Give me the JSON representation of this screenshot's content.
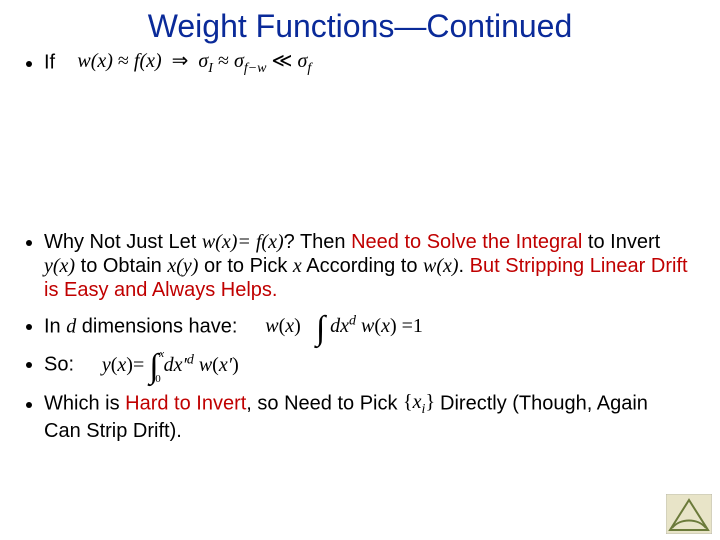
{
  "title": "Weight Functions—Continued",
  "bullets": {
    "b1_lead": "If",
    "b1_formula_wx": "w(x)",
    "b1_formula_approx": "≈",
    "b1_formula_fx": "f(x)",
    "b1_formula_implies": "⇒",
    "b1_formula_sigmaI": "σ",
    "b1_formula_sigmaI_sub": "I",
    "b1_formula_sigmafw": "σ",
    "b1_formula_sigmafw_sub": "f−w",
    "b1_formula_ll": "≪",
    "b1_formula_sigmaf": "σ",
    "b1_formula_sigmaf_sub": "f",
    "b2_p1": "Why Not Just Let ",
    "b2_wx": "w(x)= f(x)",
    "b2_p2": "? Then ",
    "b2_need": "Need to Solve the Integral",
    "b2_p3": " to Invert ",
    "b2_yx": "y(x)",
    "b2_p4": " to Obtain ",
    "b2_xy": "x(y)",
    "b2_p5": " or to Pick ",
    "b2_x": "x",
    "b2_p6": " According to ",
    "b2_wx2": "w(x)",
    "b2_p7": ". ",
    "b2_strip": "But Stripping Linear Drift is Easy and Always Helps.",
    "b3_p1": "In ",
    "b3_d": "d",
    "b3_p2": " dimensions have:",
    "b3_formula_lhs_w": "w",
    "b3_formula_lhs_xvec": "x",
    "b3_formula_int": "∫",
    "b3_formula_dx": "dx",
    "b3_formula_dsup": "d",
    "b3_formula_rhs_w": "w",
    "b3_formula_rhs_xvec": "x",
    "b3_formula_eq1": "=1",
    "b4_p1": "So:",
    "b4_lhs_y": "y",
    "b4_lhs_xvec": "x",
    "b4_int": "∫",
    "b4_int_up": "x",
    "b4_int_lo": "0",
    "b4_dxp": "dx′",
    "b4_dsup": "d",
    "b4_w": "w",
    "b4_xp": "x′",
    "b5_p1": "Which is ",
    "b5_hard": "Hard to Invert",
    "b5_p2": ", so Need to Pick ",
    "b5_set_open": "{",
    "b5_set_x": "x",
    "b5_set_i": "i",
    "b5_set_close": "}",
    "b5_p3": "Directly (Though, Again Can Strip Drift)."
  }
}
